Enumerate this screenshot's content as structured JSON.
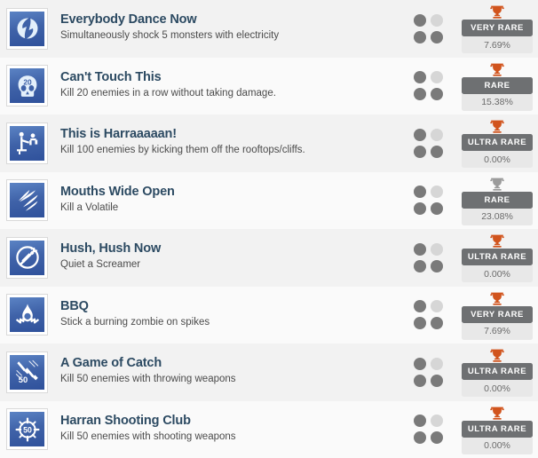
{
  "list": {
    "label": "Achievements list",
    "rarity_colors": {
      "bronze_trophy": "#d1541d",
      "silver_trophy": "#9b9b9b",
      "badge_background": "#6e7072",
      "percent_background": "#e8e8e8",
      "row_odd_background": "#f2f2f2",
      "row_even_background": "#fafafa",
      "title_color": "#2c4a62",
      "icon_blue": "#3f62a8"
    },
    "achievements": [
      {
        "title": "Everybody Dance Now",
        "description": "Simultaneously shock 5 monsters with electricity",
        "icon": "lightning-bolt-icon",
        "dots": [
          "on",
          "off",
          "on",
          "on"
        ],
        "trophy": "bronze",
        "rarity": "VERY RARE",
        "percent": "7.69%"
      },
      {
        "title": "Can't Touch This",
        "description": "Kill 20 enemies in a row without taking damage.",
        "icon": "skull-20-icon",
        "dots": [
          "on",
          "off",
          "on",
          "on"
        ],
        "trophy": "bronze",
        "rarity": "RARE",
        "percent": "15.38%"
      },
      {
        "title": "This is Harraaaaan!",
        "description": "Kill 100 enemies by kicking them off the rooftops/cliffs.",
        "icon": "kick-off-ledge-icon",
        "dots": [
          "on",
          "off",
          "on",
          "on"
        ],
        "trophy": "bronze",
        "rarity": "ULTRA RARE",
        "percent": "0.00%"
      },
      {
        "title": "Mouths Wide Open",
        "description": "Kill a Volatile",
        "icon": "claw-marks-icon",
        "dots": [
          "on",
          "off",
          "on",
          "on"
        ],
        "trophy": "silver",
        "rarity": "RARE",
        "percent": "23.08%"
      },
      {
        "title": "Hush, Hush Now",
        "description": "Quiet a Screamer",
        "icon": "no-noise-icon",
        "dots": [
          "on",
          "off",
          "on",
          "on"
        ],
        "trophy": "bronze",
        "rarity": "ULTRA RARE",
        "percent": "0.00%"
      },
      {
        "title": "BBQ",
        "description": "Stick a burning zombie on spikes",
        "icon": "flame-spike-icon",
        "dots": [
          "on",
          "off",
          "on",
          "on"
        ],
        "trophy": "bronze",
        "rarity": "VERY RARE",
        "percent": "7.69%"
      },
      {
        "title": "A Game of Catch",
        "description": "Kill 50 enemies with throwing weapons",
        "icon": "throwing-knife-50-icon",
        "dots": [
          "on",
          "off",
          "on",
          "on"
        ],
        "trophy": "bronze",
        "rarity": "ULTRA RARE",
        "percent": "0.00%"
      },
      {
        "title": "Harran Shooting Club",
        "description": "Kill 50 enemies with shooting weapons",
        "icon": "crosshair-50-icon",
        "dots": [
          "on",
          "off",
          "on",
          "on"
        ],
        "trophy": "bronze",
        "rarity": "ULTRA RARE",
        "percent": "0.00%"
      }
    ]
  }
}
